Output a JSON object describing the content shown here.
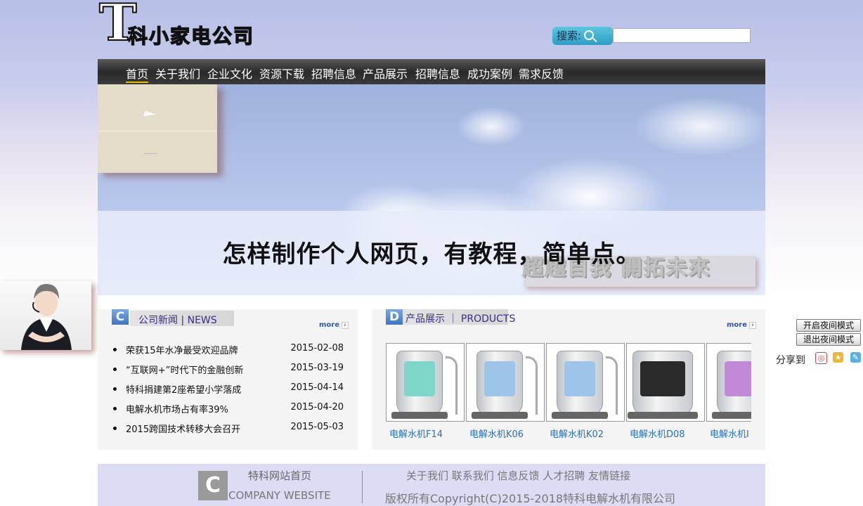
{
  "header": {
    "logo_letter": "T",
    "logo_text": "科小家电公司",
    "search_label": "搜索:",
    "search_value": ""
  },
  "nav": {
    "items": [
      "首页",
      "关于我们",
      "企业文化",
      "资源下载",
      "招聘信息",
      "产品展示",
      "招聘信息",
      "成功案例",
      "需求反馈"
    ]
  },
  "banner": {
    "slogan": "超越自我 開拓未來",
    "headline": "怎样制作个人网页，有教程，简单点。"
  },
  "news": {
    "badge": "C",
    "title": "公司新闻 | NEWS",
    "more": "more",
    "items": [
      {
        "title": "荣获15年水净最受欢迎品牌",
        "date": "2015-02-08"
      },
      {
        "title": "“互联网+”时代下的金融创新",
        "date": "2015-03-19"
      },
      {
        "title": "特科捐建第2座希望小学落成",
        "date": "2015-04-14"
      },
      {
        "title": "电解水机市场占有率39%",
        "date": "2015-04-20"
      },
      {
        "title": "2015跨国技术转移大会召开",
        "date": "2015-05-03"
      }
    ]
  },
  "products": {
    "badge": "D",
    "title": "产品展示 ｜ PRODUCTS",
    "more": "more",
    "items": [
      {
        "name": "电解水机F14",
        "screen": "#7fd6c8"
      },
      {
        "name": "电解水机K06",
        "screen": "#9fc4ea"
      },
      {
        "name": "电解水机K02",
        "screen": "#9fc4ea"
      },
      {
        "name": "电解水机D08",
        "screen": "#2a2a2a"
      },
      {
        "name": "电解水机I",
        "screen": "#c28ad6"
      }
    ]
  },
  "night_mode": {
    "on_label": "开启夜间模式",
    "off_label": "退出夜间模式"
  },
  "share": {
    "label": "分享到",
    "icons": [
      "weibo-icon",
      "qzone-icon",
      "tencent-weibo-icon"
    ]
  },
  "footer": {
    "logo": "C",
    "site_home": "特科网站首页",
    "company_website": "COMPANY WEBSITE",
    "links": "关于我们 联系我们 信息反馈 人才招聘 友情链接",
    "copyright": "版权所有Copyright(C)2015-2018特科电解水机有限公司"
  }
}
